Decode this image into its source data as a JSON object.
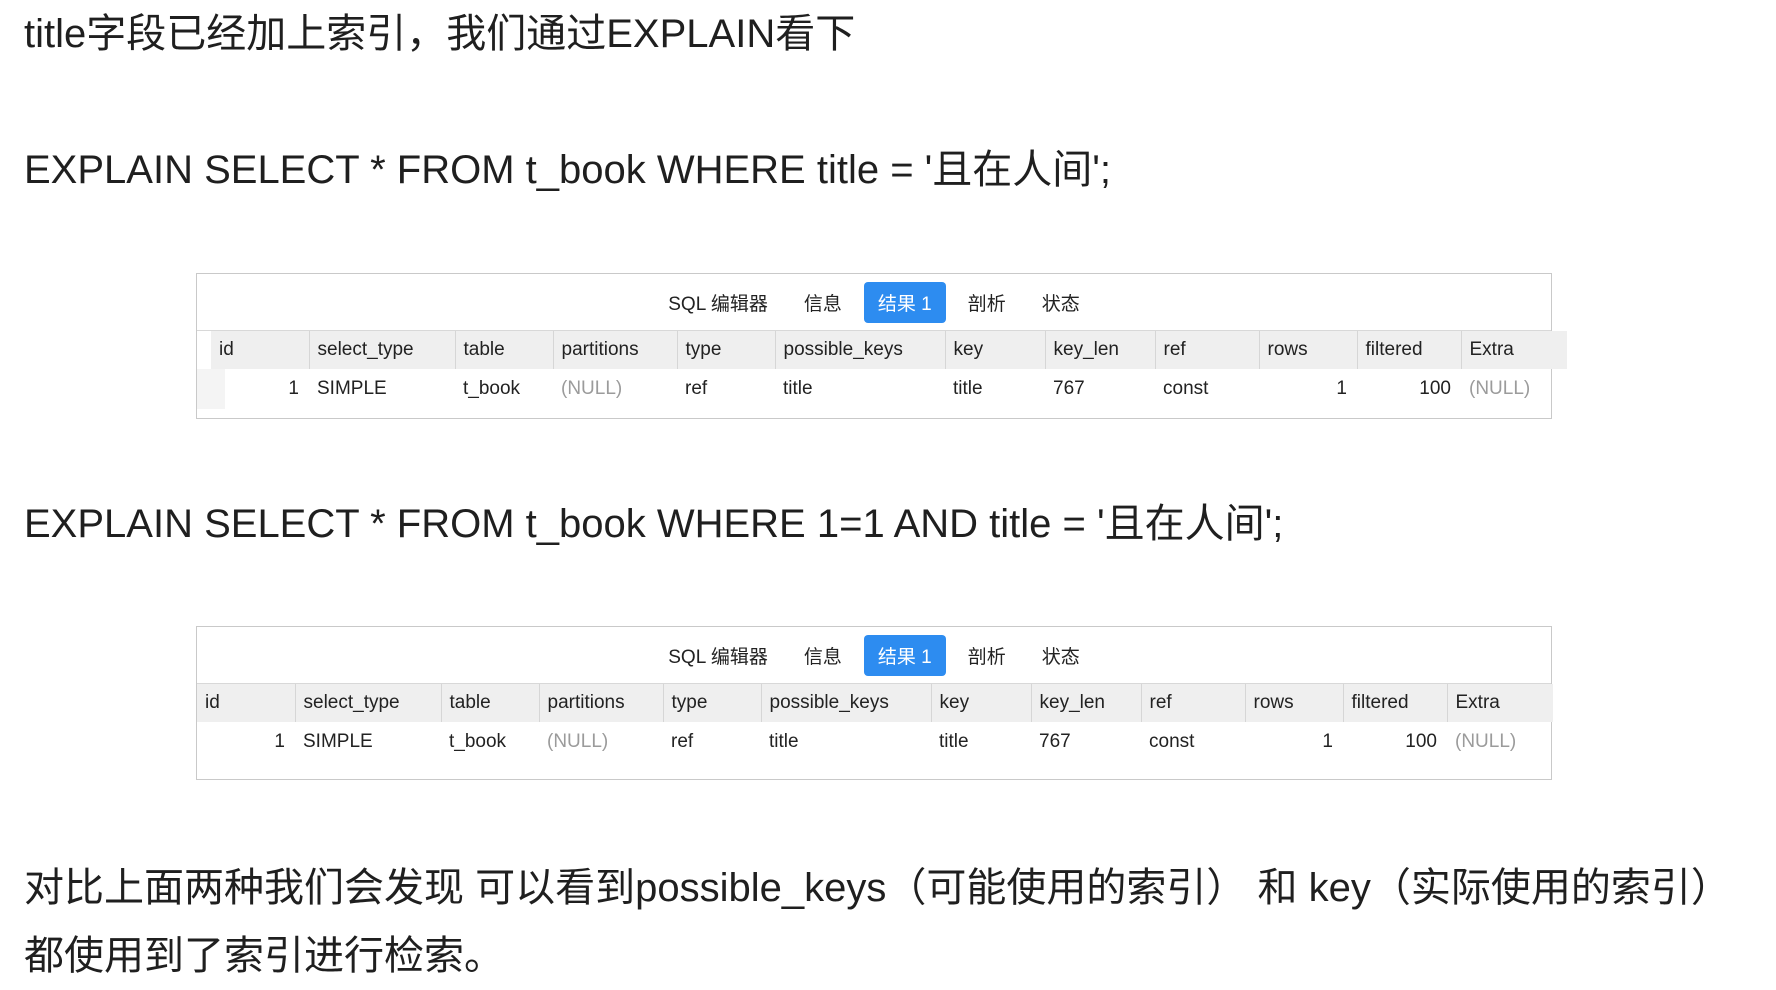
{
  "paragraphs": {
    "intro": "title字段已经加上索引，我们通过EXPLAIN看下",
    "sql1": "EXPLAIN SELECT * FROM t_book WHERE title = '且在人间';",
    "sql2": "EXPLAIN SELECT * FROM t_book WHERE 1=1 AND title = '且在人间';",
    "conclusion": "对比上面两种我们会发现 可以看到possible_keys（可能使用的索引） 和 key（实际使用的索引）都使用到了索引进行检索。"
  },
  "panels": [
    {
      "tabs": [
        "SQL 编辑器",
        "信息",
        "结果 1",
        "剖析",
        "状态"
      ],
      "active_tab": "结果 1",
      "columns": [
        "id",
        "select_type",
        "table",
        "partitions",
        "type",
        "possible_keys",
        "key",
        "key_len",
        "ref",
        "rows",
        "filtered",
        "Extra"
      ],
      "row": [
        "1",
        "SIMPLE",
        "t_book",
        "(NULL)",
        "ref",
        "title",
        "title",
        "767",
        "const",
        "1",
        "100",
        "(NULL)"
      ]
    },
    {
      "tabs": [
        "SQL 编辑器",
        "信息",
        "结果 1",
        "剖析",
        "状态"
      ],
      "active_tab": "结果 1",
      "columns": [
        "id",
        "select_type",
        "table",
        "partitions",
        "type",
        "possible_keys",
        "key",
        "key_len",
        "ref",
        "rows",
        "filtered",
        "Extra"
      ],
      "row": [
        "1",
        "SIMPLE",
        "t_book",
        "(NULL)",
        "ref",
        "title",
        "title",
        "767",
        "const",
        "1",
        "100",
        "(NULL)"
      ]
    }
  ],
  "colors": {
    "active_tab": "#2d8cf0",
    "header_bg": "#efefef",
    "null_text": "#9b9b9b"
  }
}
